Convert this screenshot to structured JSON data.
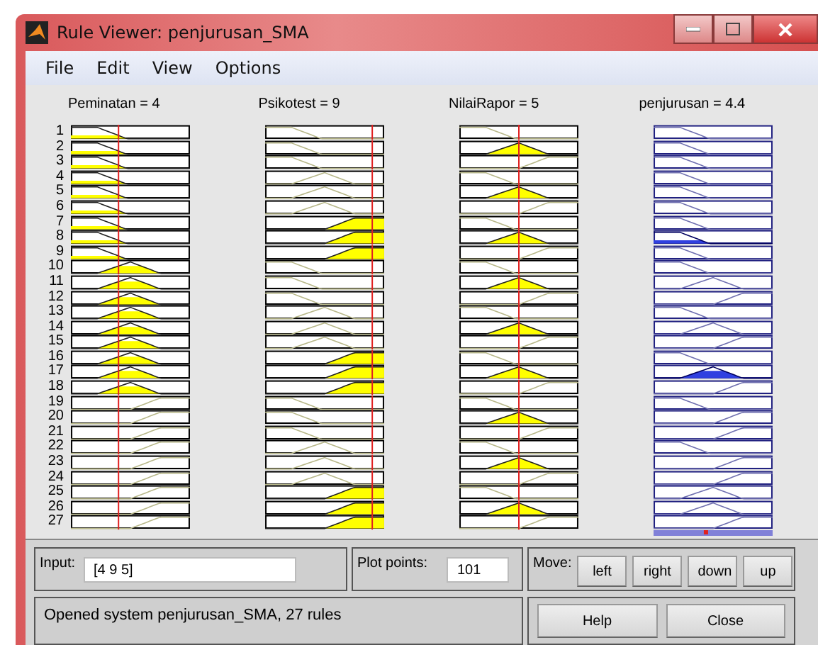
{
  "window": {
    "title": "Rule Viewer: penjurusan_SMA"
  },
  "menu": [
    "File",
    "Edit",
    "View",
    "Options"
  ],
  "inputs": [
    {
      "label": "Peminatan = 4"
    },
    {
      "label": "Psikotest = 9"
    },
    {
      "label": "NilaiRapor = 5"
    }
  ],
  "output": {
    "label": "penjurusan = 4.4"
  },
  "rules": [
    {
      "number": "1",
      "plots": [
        {
          "kind": "low"
        },
        {
          "kind": "low"
        },
        {
          "kind": "low"
        },
        {
          "kind": "low"
        }
      ]
    },
    {
      "number": "2",
      "plots": [
        {
          "kind": "low"
        },
        {
          "kind": "low"
        },
        {
          "kind": "mid"
        },
        {
          "kind": "low"
        }
      ]
    },
    {
      "number": "3",
      "plots": [
        {
          "kind": "low"
        },
        {
          "kind": "low"
        },
        {
          "kind": "high"
        },
        {
          "kind": "low"
        }
      ]
    },
    {
      "number": "4",
      "plots": [
        {
          "kind": "low"
        },
        {
          "kind": "mid"
        },
        {
          "kind": "low"
        },
        {
          "kind": "low"
        }
      ]
    },
    {
      "number": "5",
      "plots": [
        {
          "kind": "low"
        },
        {
          "kind": "mid"
        },
        {
          "kind": "mid"
        },
        {
          "kind": "low"
        }
      ]
    },
    {
      "number": "6",
      "plots": [
        {
          "kind": "low"
        },
        {
          "kind": "mid"
        },
        {
          "kind": "high"
        },
        {
          "kind": "low"
        }
      ]
    },
    {
      "number": "7",
      "plots": [
        {
          "kind": "low"
        },
        {
          "kind": "high"
        },
        {
          "kind": "low"
        },
        {
          "kind": "low"
        }
      ]
    },
    {
      "number": "8",
      "plots": [
        {
          "kind": "low"
        },
        {
          "kind": "high"
        },
        {
          "kind": "mid"
        },
        {
          "kind": "low"
        }
      ]
    },
    {
      "number": "9",
      "plots": [
        {
          "kind": "low"
        },
        {
          "kind": "high"
        },
        {
          "kind": "high"
        },
        {
          "kind": "low"
        }
      ]
    },
    {
      "number": "10",
      "plots": [
        {
          "kind": "mid"
        },
        {
          "kind": "low"
        },
        {
          "kind": "low"
        },
        {
          "kind": "low"
        }
      ]
    },
    {
      "number": "11",
      "plots": [
        {
          "kind": "mid"
        },
        {
          "kind": "low"
        },
        {
          "kind": "mid"
        },
        {
          "kind": "mid"
        }
      ]
    },
    {
      "number": "12",
      "plots": [
        {
          "kind": "mid"
        },
        {
          "kind": "low"
        },
        {
          "kind": "high"
        },
        {
          "kind": "high"
        }
      ]
    },
    {
      "number": "13",
      "plots": [
        {
          "kind": "mid"
        },
        {
          "kind": "mid"
        },
        {
          "kind": "low"
        },
        {
          "kind": "low"
        }
      ]
    },
    {
      "number": "14",
      "plots": [
        {
          "kind": "mid"
        },
        {
          "kind": "mid"
        },
        {
          "kind": "mid"
        },
        {
          "kind": "mid"
        }
      ]
    },
    {
      "number": "15",
      "plots": [
        {
          "kind": "mid"
        },
        {
          "kind": "mid"
        },
        {
          "kind": "high"
        },
        {
          "kind": "high"
        }
      ]
    },
    {
      "number": "16",
      "plots": [
        {
          "kind": "mid"
        },
        {
          "kind": "high"
        },
        {
          "kind": "low"
        },
        {
          "kind": "low"
        }
      ]
    },
    {
      "number": "17",
      "plots": [
        {
          "kind": "mid"
        },
        {
          "kind": "high"
        },
        {
          "kind": "mid"
        },
        {
          "kind": "mid"
        }
      ]
    },
    {
      "number": "18",
      "plots": [
        {
          "kind": "mid"
        },
        {
          "kind": "high"
        },
        {
          "kind": "high"
        },
        {
          "kind": "high"
        }
      ]
    },
    {
      "number": "19",
      "plots": [
        {
          "kind": "high"
        },
        {
          "kind": "low"
        },
        {
          "kind": "low"
        },
        {
          "kind": "low"
        }
      ]
    },
    {
      "number": "20",
      "plots": [
        {
          "kind": "high"
        },
        {
          "kind": "low"
        },
        {
          "kind": "mid"
        },
        {
          "kind": "high"
        }
      ]
    },
    {
      "number": "21",
      "plots": [
        {
          "kind": "high"
        },
        {
          "kind": "low"
        },
        {
          "kind": "high"
        },
        {
          "kind": "high"
        }
      ]
    },
    {
      "number": "22",
      "plots": [
        {
          "kind": "high"
        },
        {
          "kind": "mid"
        },
        {
          "kind": "low"
        },
        {
          "kind": "low"
        }
      ]
    },
    {
      "number": "23",
      "plots": [
        {
          "kind": "high"
        },
        {
          "kind": "mid"
        },
        {
          "kind": "mid"
        },
        {
          "kind": "high"
        }
      ]
    },
    {
      "number": "24",
      "plots": [
        {
          "kind": "high"
        },
        {
          "kind": "mid"
        },
        {
          "kind": "high"
        },
        {
          "kind": "high"
        }
      ]
    },
    {
      "number": "25",
      "plots": [
        {
          "kind": "high"
        },
        {
          "kind": "high"
        },
        {
          "kind": "low"
        },
        {
          "kind": "mid"
        }
      ]
    },
    {
      "number": "26",
      "plots": [
        {
          "kind": "high"
        },
        {
          "kind": "high"
        },
        {
          "kind": "mid"
        },
        {
          "kind": "mid"
        }
      ]
    },
    {
      "number": "27",
      "plots": [
        {
          "kind": "high"
        },
        {
          "kind": "high"
        },
        {
          "kind": "high"
        },
        {
          "kind": "high"
        }
      ]
    }
  ],
  "input_field": {
    "label": "Input:",
    "value": "[4 9 5]"
  },
  "plot_points": {
    "label": "Plot points:",
    "value": "101"
  },
  "move": {
    "label": "Move:",
    "buttons": [
      "left",
      "right",
      "down",
      "up"
    ]
  },
  "status": "Opened system penjurusan_SMA, 27 rules",
  "buttons": [
    "Help",
    "Close"
  ]
}
